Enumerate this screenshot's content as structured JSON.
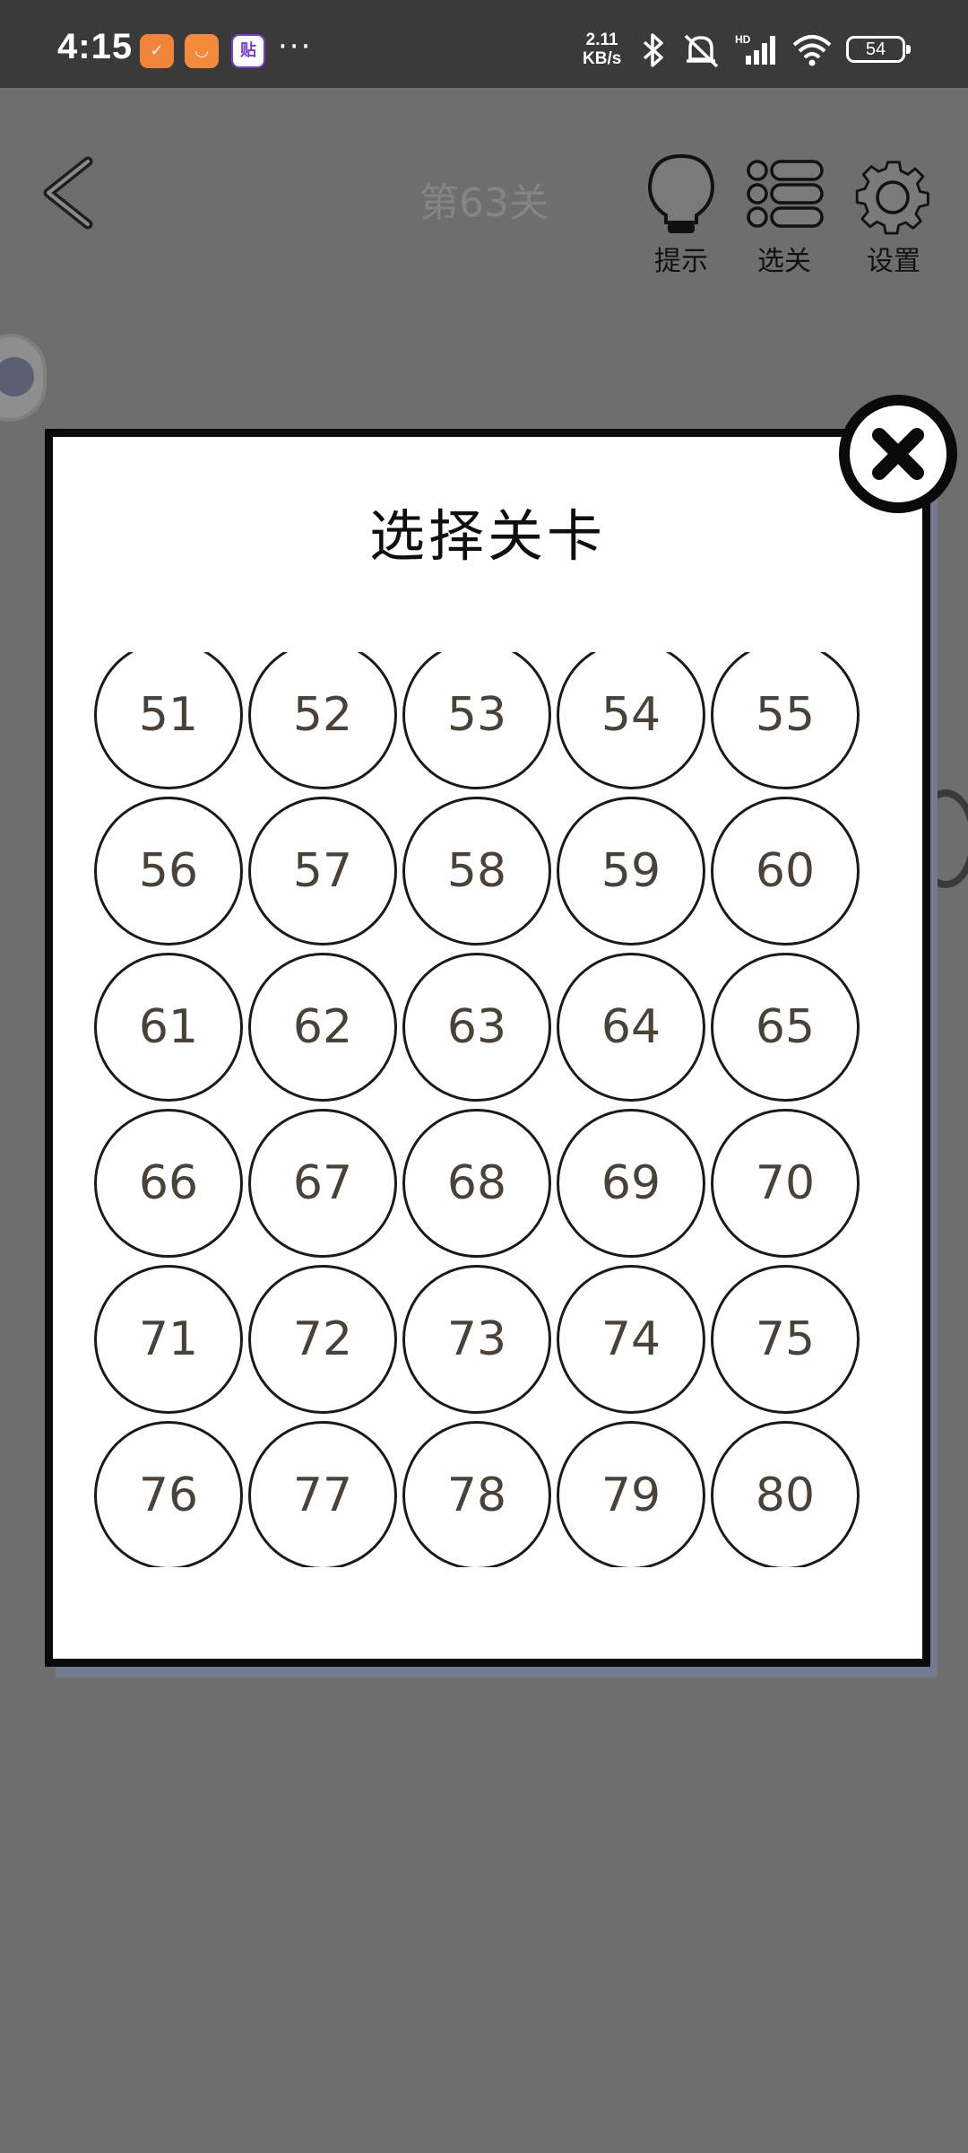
{
  "status_bar": {
    "time": "4:15",
    "net_speed_value": "2.11",
    "net_speed_unit": "KB/s",
    "battery": "54",
    "more": "···",
    "icons": [
      "app-icon-1",
      "app-icon-2",
      "app-icon-3",
      "bluetooth-icon",
      "mute-icon",
      "signal-icon",
      "wifi-icon",
      "battery-icon"
    ]
  },
  "header": {
    "level_title": "第63关",
    "hint_label": "提示",
    "select_label": "选关",
    "settings_label": "设置"
  },
  "modal": {
    "title": "选择关卡",
    "levels": [
      "51",
      "52",
      "53",
      "54",
      "55",
      "56",
      "57",
      "58",
      "59",
      "60",
      "61",
      "62",
      "63",
      "64",
      "65",
      "66",
      "67",
      "68",
      "69",
      "70",
      "71",
      "72",
      "73",
      "74",
      "75",
      "76",
      "77",
      "78",
      "79",
      "80"
    ]
  },
  "colors": {
    "overlay": "#6e6e6e",
    "modal_bg": "#ffffff",
    "modal_border": "#0a0a0a",
    "level_text": "#4a4238"
  }
}
